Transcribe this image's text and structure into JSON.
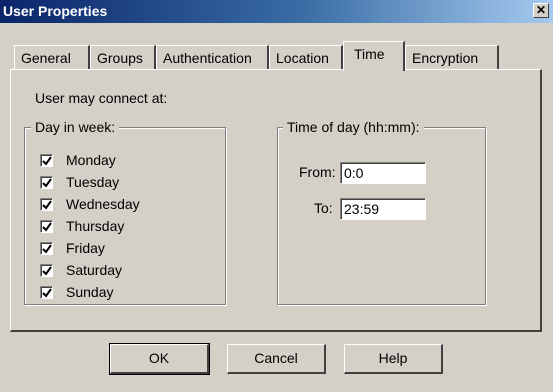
{
  "window": {
    "title": "User Properties",
    "close_glyph": "✕"
  },
  "tabs": [
    {
      "label": "General",
      "active": false
    },
    {
      "label": "Groups",
      "active": false
    },
    {
      "label": "Authentication",
      "active": false
    },
    {
      "label": "Location",
      "active": false
    },
    {
      "label": "Time",
      "active": true
    },
    {
      "label": "Encryption",
      "active": false
    }
  ],
  "time_tab": {
    "intro": "User may connect at:",
    "days_group": {
      "legend": "Day in week:",
      "days": [
        {
          "label": "Monday",
          "checked": true
        },
        {
          "label": "Tuesday",
          "checked": true
        },
        {
          "label": "Wednesday",
          "checked": true
        },
        {
          "label": "Thursday",
          "checked": true
        },
        {
          "label": "Friday",
          "checked": true
        },
        {
          "label": "Saturday",
          "checked": true
        },
        {
          "label": "Sunday",
          "checked": true
        }
      ]
    },
    "time_group": {
      "legend": "Time of day (hh:mm):",
      "from_label": "From:",
      "from_value": "0:0",
      "to_label": "To:",
      "to_value": "23:59"
    }
  },
  "buttons": {
    "ok": "OK",
    "cancel": "Cancel",
    "help": "Help"
  },
  "colors": {
    "titlebar_start": "#0a246a",
    "titlebar_end": "#a6caf0",
    "dialog_face": "#d4d0c8"
  }
}
